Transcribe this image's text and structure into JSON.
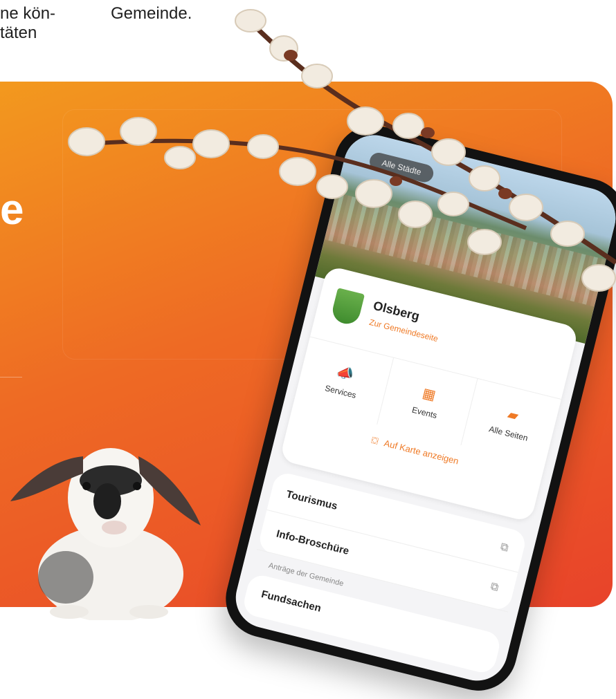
{
  "top_text": {
    "left_line1": "ne kön-",
    "left_line2": "täten",
    "right": "Gemeinde."
  },
  "banner": {
    "headline_fragment": "e",
    "colors": {
      "gradient_start": "#f39a1e",
      "gradient_mid": "#ee6a24",
      "gradient_end": "#e8432a"
    }
  },
  "phone": {
    "hero_pill": "Alle Städte",
    "town": {
      "name": "Olsberg",
      "link": "Zur Gemeindeseite"
    },
    "quick_actions": [
      {
        "label": "Services",
        "icon": "megaphone-icon"
      },
      {
        "label": "Events",
        "icon": "calendar-icon"
      },
      {
        "label": "Alle Seiten",
        "icon": "folder-icon"
      }
    ],
    "map_link": "Auf Karte anzeigen",
    "list": [
      {
        "label": "Tourismus",
        "icon": "external-link-icon"
      },
      {
        "label": "Info-Broschüre",
        "icon": "external-link-icon"
      }
    ],
    "section_label": "Anträge der Gemeinde",
    "list2_label": "Fundsachen",
    "accent_color": "#ef7a26"
  }
}
